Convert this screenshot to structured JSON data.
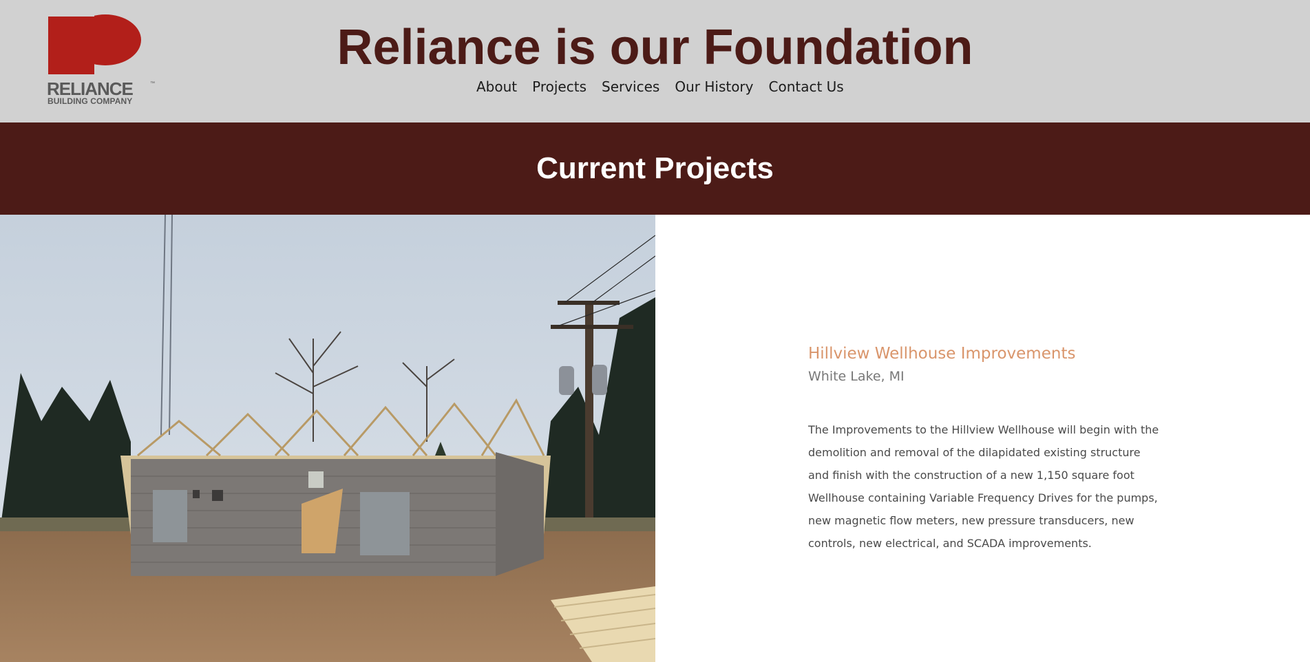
{
  "header": {
    "logo": {
      "word": "RELIANCE",
      "tm": "™",
      "sub": "BUILDING COMPANY",
      "color": "#b21f1a"
    },
    "title": "Reliance is our Foundation",
    "nav": [
      "About",
      "Projects",
      "Services",
      "Our History",
      "Contact Us"
    ]
  },
  "band": {
    "title": "Current Projects",
    "color": "#4c1b17"
  },
  "project": {
    "title": "Hillview Wellhouse Improvements",
    "location": "White Lake, MI",
    "description": "The Improvements to the Hillview Wellhouse will begin with the demolition and removal of the dilapidated existing structure and finish with the construction of a new 1,150 square foot Wellhouse containing Variable Frequency Drives for the pumps, new magnetic flow meters, new pressure transducers, new controls, new electrical, and SCADA improvements.",
    "title_color": "#d9956b"
  }
}
